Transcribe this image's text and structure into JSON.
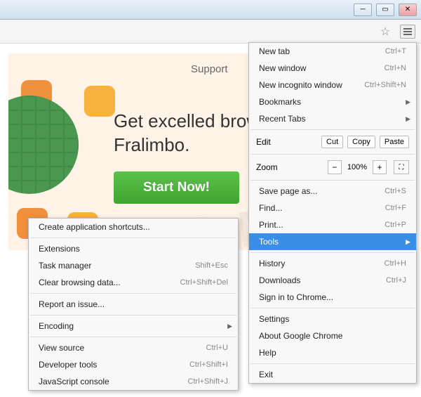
{
  "page": {
    "support": "Support",
    "headline_line1": "Get excelled brow",
    "headline_line2": "Fralimbo.",
    "cta": "Start Now!"
  },
  "mainMenu": {
    "newTab": {
      "label": "New tab",
      "shortcut": "Ctrl+T"
    },
    "newWindow": {
      "label": "New window",
      "shortcut": "Ctrl+N"
    },
    "newIncognito": {
      "label": "New incognito window",
      "shortcut": "Ctrl+Shift+N"
    },
    "bookmarks": {
      "label": "Bookmarks"
    },
    "recentTabs": {
      "label": "Recent Tabs"
    },
    "edit": {
      "label": "Edit",
      "cut": "Cut",
      "copy": "Copy",
      "paste": "Paste"
    },
    "zoom": {
      "label": "Zoom",
      "minus": "−",
      "value": "100%",
      "plus": "+"
    },
    "savePage": {
      "label": "Save page as...",
      "shortcut": "Ctrl+S"
    },
    "find": {
      "label": "Find...",
      "shortcut": "Ctrl+F"
    },
    "print": {
      "label": "Print...",
      "shortcut": "Ctrl+P"
    },
    "tools": {
      "label": "Tools"
    },
    "history": {
      "label": "History",
      "shortcut": "Ctrl+H"
    },
    "downloads": {
      "label": "Downloads",
      "shortcut": "Ctrl+J"
    },
    "signin": {
      "label": "Sign in to Chrome..."
    },
    "settings": {
      "label": "Settings"
    },
    "about": {
      "label": "About Google Chrome"
    },
    "help": {
      "label": "Help"
    },
    "exit": {
      "label": "Exit"
    }
  },
  "subMenu": {
    "createShortcuts": {
      "label": "Create application shortcuts..."
    },
    "extensions": {
      "label": "Extensions"
    },
    "taskManager": {
      "label": "Task manager",
      "shortcut": "Shift+Esc"
    },
    "clearData": {
      "label": "Clear browsing data...",
      "shortcut": "Ctrl+Shift+Del"
    },
    "reportIssue": {
      "label": "Report an issue..."
    },
    "encoding": {
      "label": "Encoding"
    },
    "viewSource": {
      "label": "View source",
      "shortcut": "Ctrl+U"
    },
    "devTools": {
      "label": "Developer tools",
      "shortcut": "Ctrl+Shift+I"
    },
    "jsConsole": {
      "label": "JavaScript console",
      "shortcut": "Ctrl+Shift+J"
    }
  }
}
